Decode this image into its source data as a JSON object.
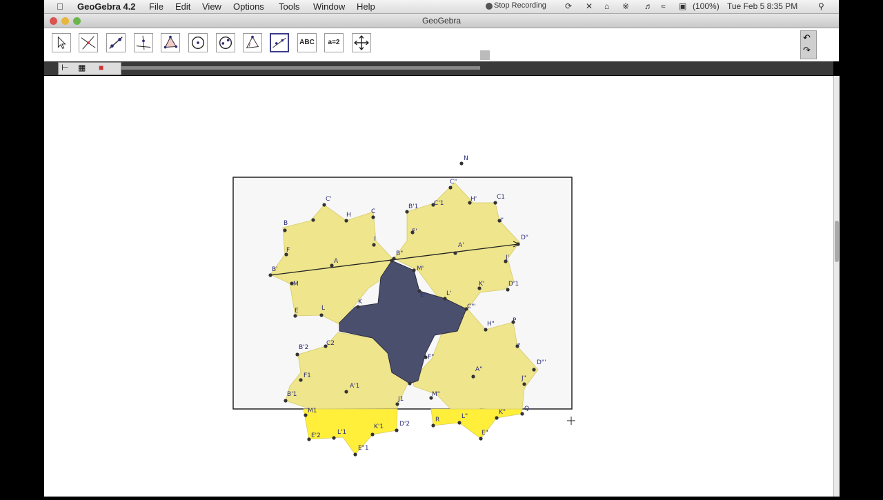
{
  "menubar": {
    "app_name": "GeoGebra 4.2",
    "items": [
      "File",
      "Edit",
      "View",
      "Options",
      "Tools",
      "Window",
      "Help"
    ],
    "recording": "Stop Recording",
    "battery": "(100%)",
    "datetime": "Tue Feb 5  8:35 PM"
  },
  "window": {
    "title": "GeoGebra"
  },
  "toolbar": {
    "tools": [
      {
        "name": "move-tool",
        "label": ""
      },
      {
        "name": "intersect-tool",
        "label": ""
      },
      {
        "name": "line-tool",
        "label": ""
      },
      {
        "name": "perpendicular-tool",
        "label": ""
      },
      {
        "name": "polygon-tool",
        "label": ""
      },
      {
        "name": "circle-tool",
        "label": ""
      },
      {
        "name": "conic-tool",
        "label": ""
      },
      {
        "name": "angle-tool",
        "label": ""
      },
      {
        "name": "reflect-tool",
        "label": ""
      },
      {
        "name": "text-tool",
        "label": "ABC"
      },
      {
        "name": "slider-tool",
        "label": "a=2"
      },
      {
        "name": "move-view-tool",
        "label": ""
      }
    ]
  },
  "colors": {
    "polygon_fill": "#eee58c",
    "polygon_bright": "#ffef3a",
    "overlap": "#4b4f6e",
    "points": "#333333",
    "labels": "#2b2b7a"
  },
  "points": {
    "N": "N",
    "B": "B",
    "C_prime": "C'",
    "H": "H",
    "C": "C",
    "F": "F",
    "B_prime": "B'",
    "A": "A",
    "M": "M",
    "E": "E",
    "L": "L",
    "K": "K",
    "I": "I",
    "B_prime_1": "B'1",
    "C_dprime": "C\"",
    "C_prime_1": "C'1",
    "H_prime": "H'",
    "C_1": "C1",
    "F_prime": "F'",
    "I_prime": "I'",
    "D_dprime": "D\"",
    "A_prime": "A'",
    "B_dprime": "B\"",
    "M_prime": "M'",
    "J_prime": "J'",
    "D_prime_1": "D'1",
    "K_prime": "K'",
    "E_prime": "E'",
    "L_prime": "L'",
    "C_tprime": "C\"'",
    "H_dprime": "H\"",
    "P": "P",
    "I_dprime": "I\"",
    "D_tprime": "D\"'",
    "A_dprime": "A\"",
    "F_dprime": "F\"",
    "J_dprime": "J\"",
    "M_dprime": "M\"",
    "Q": "Q",
    "K_dprime": "K\"",
    "L_dprime": "L\"",
    "E_dprime": "E\"",
    "R": "R",
    "B_prime_2": "B'2",
    "C_2": "C2",
    "F_1": "F1",
    "A_1": "A'1",
    "J_1": "J1",
    "B_1": "B'1",
    "M_1": "M1",
    "E_2": "E'2",
    "L_1": "L'1",
    "K_1": "K'1",
    "D_2": "D'2",
    "E_1": "E\"1"
  }
}
